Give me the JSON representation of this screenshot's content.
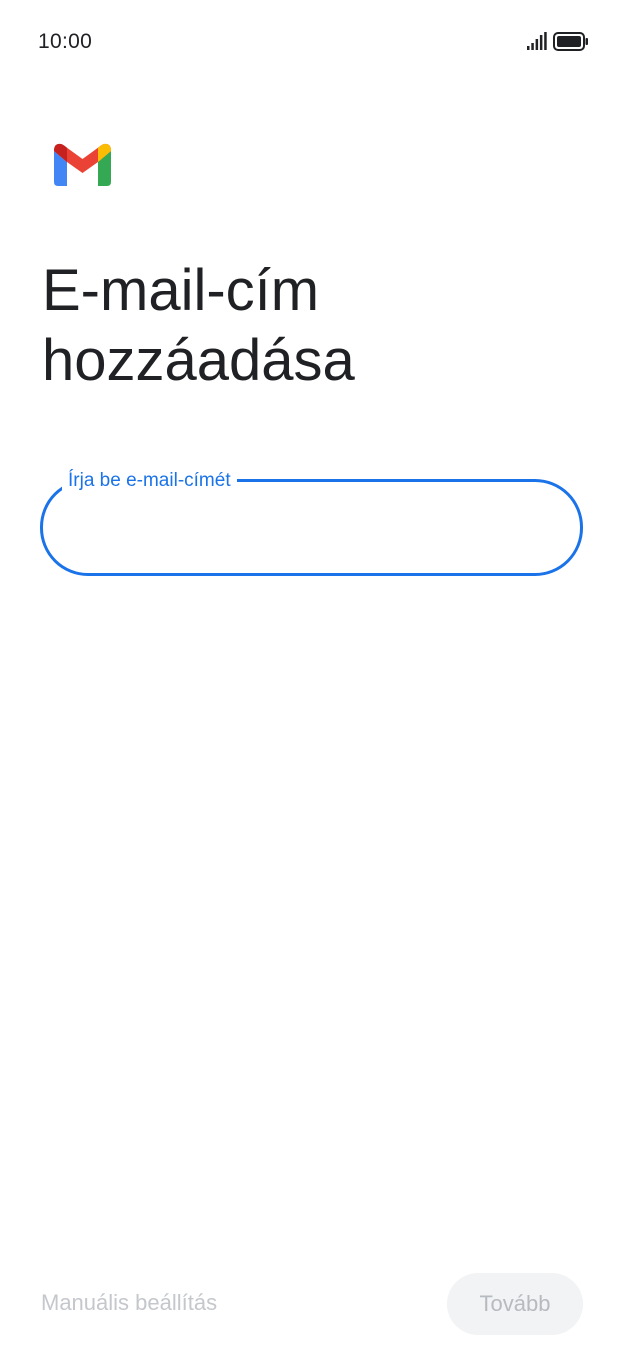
{
  "status_bar": {
    "time": "10:00",
    "signal_icon": "cellular-signal-icon",
    "battery_icon": "battery-full-icon"
  },
  "logo": {
    "icon": "gmail-logo",
    "colors": {
      "red": "#ea4335",
      "blue": "#4285f4",
      "green": "#34a853",
      "yellow": "#fbbc04",
      "dark_red": "#c5221f"
    }
  },
  "title": {
    "line1": "E-mail-cím",
    "line2": "hozzáadása"
  },
  "email_field": {
    "label": "Írja be e-mail-címét",
    "value": "",
    "placeholder": "",
    "accent_color": "#1a73e8"
  },
  "actions": {
    "manual_setup_label": "Manuális beállítás",
    "next_label": "Tovább"
  }
}
